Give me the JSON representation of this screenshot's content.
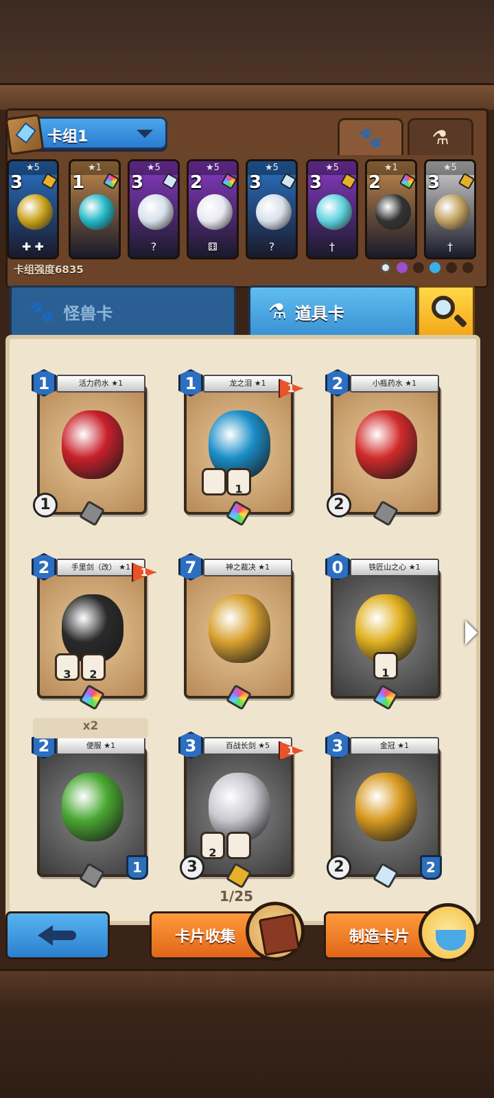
{
  "deck": {
    "name": "卡组1",
    "power_label": "卡组强度6835",
    "tabs": [
      "paw-icon",
      "potion-icon"
    ],
    "cards": [
      {
        "stars": "★5",
        "cost": "3",
        "color": "#2a73c8",
        "art": "#c9a21a",
        "gem": "#e8b028",
        "sub": "✚ ✚"
      },
      {
        "stars": "★1",
        "cost": "1",
        "color": "#c48a4a",
        "art": "#23b6c6",
        "gem": "rainbow",
        "sub": ""
      },
      {
        "stars": "★5",
        "cost": "3",
        "color": "#8a3ac6",
        "art": "#d8e0ea",
        "gem": "#cfe6f7",
        "sub": "?"
      },
      {
        "stars": "★5",
        "cost": "2",
        "color": "#8a3ac6",
        "art": "#e8e8f0",
        "gem": "rainbow",
        "sub": "⚅"
      },
      {
        "stars": "★5",
        "cost": "3",
        "color": "#2a73c8",
        "art": "#d8e0ea",
        "gem": "#cfe6f7",
        "sub": "?"
      },
      {
        "stars": "★5",
        "cost": "3",
        "color": "#8a3ac6",
        "art": "#5fd3e0",
        "gem": "#e8b028",
        "sub": "†"
      },
      {
        "stars": "★1",
        "cost": "2",
        "color": "#c48a4a",
        "art": "#333333",
        "gem": "rainbow",
        "sub": ""
      },
      {
        "stars": "★5",
        "cost": "3",
        "color": "#d6d6d6",
        "art": "#c0a060",
        "gem": "#e8b028",
        "sub": "†"
      }
    ]
  },
  "category_tabs": {
    "monster": "怪兽卡",
    "item": "道具卡"
  },
  "grid": [
    {
      "name": "活力药水 ★1",
      "cost": "1",
      "art": "#c8202a",
      "frame": "light",
      "gem": "grey",
      "left": "1",
      "right": "",
      "flag": ""
    },
    {
      "name": "龙之泪 ★1",
      "cost": "1",
      "art": "#1a8ec8",
      "frame": "light",
      "gem": "rainbow",
      "left": "",
      "right": "",
      "flag": "1"
    },
    {
      "name": "小瓶药水 ★1",
      "cost": "2",
      "art": "#d22a2a",
      "frame": "light",
      "gem": "grey",
      "left": "2",
      "right": "",
      "flag": ""
    },
    {
      "name": "手里剑（改） ★1",
      "cost": "2",
      "art": "#2a2a2a",
      "frame": "light",
      "gem": "rainbow",
      "left": "",
      "right": "",
      "flag": "1"
    },
    {
      "name": "神之裁决 ★1",
      "cost": "7",
      "art": "#d8a030",
      "frame": "light",
      "gem": "rainbow",
      "left": "",
      "right": "",
      "flag": ""
    },
    {
      "name": "铁匠山之心 ★1",
      "cost": "0",
      "art": "#e0b020",
      "frame": "dark",
      "gem": "rainbow",
      "left": "",
      "right": "",
      "flag": ""
    },
    {
      "name": "便服 ★1",
      "cost": "2",
      "art": "#4aa832",
      "frame": "dark",
      "gem": "grey",
      "left": "",
      "right": "1",
      "flag": ""
    },
    {
      "name": "百战长剑 ★5",
      "cost": "3",
      "art": "#c8c8d0",
      "frame": "dark",
      "gem": "gold",
      "left": "3",
      "right": "",
      "flag": "1"
    },
    {
      "name": "金冠 ★1",
      "cost": "3",
      "art": "#d89a20",
      "frame": "dark",
      "gem": "ice",
      "left": "2",
      "right": "2",
      "flag": ""
    }
  ],
  "badges": {
    "dragon_a": "",
    "dragon_b": "1",
    "shuriken_a": "3",
    "shuriken_b": "2",
    "heart": "1",
    "sword_a": "2",
    "sword_b": ""
  },
  "duplicate_label": "x2",
  "pager": "1/25",
  "buttons": {
    "collect": "卡片收集",
    "craft": "制造卡片"
  }
}
